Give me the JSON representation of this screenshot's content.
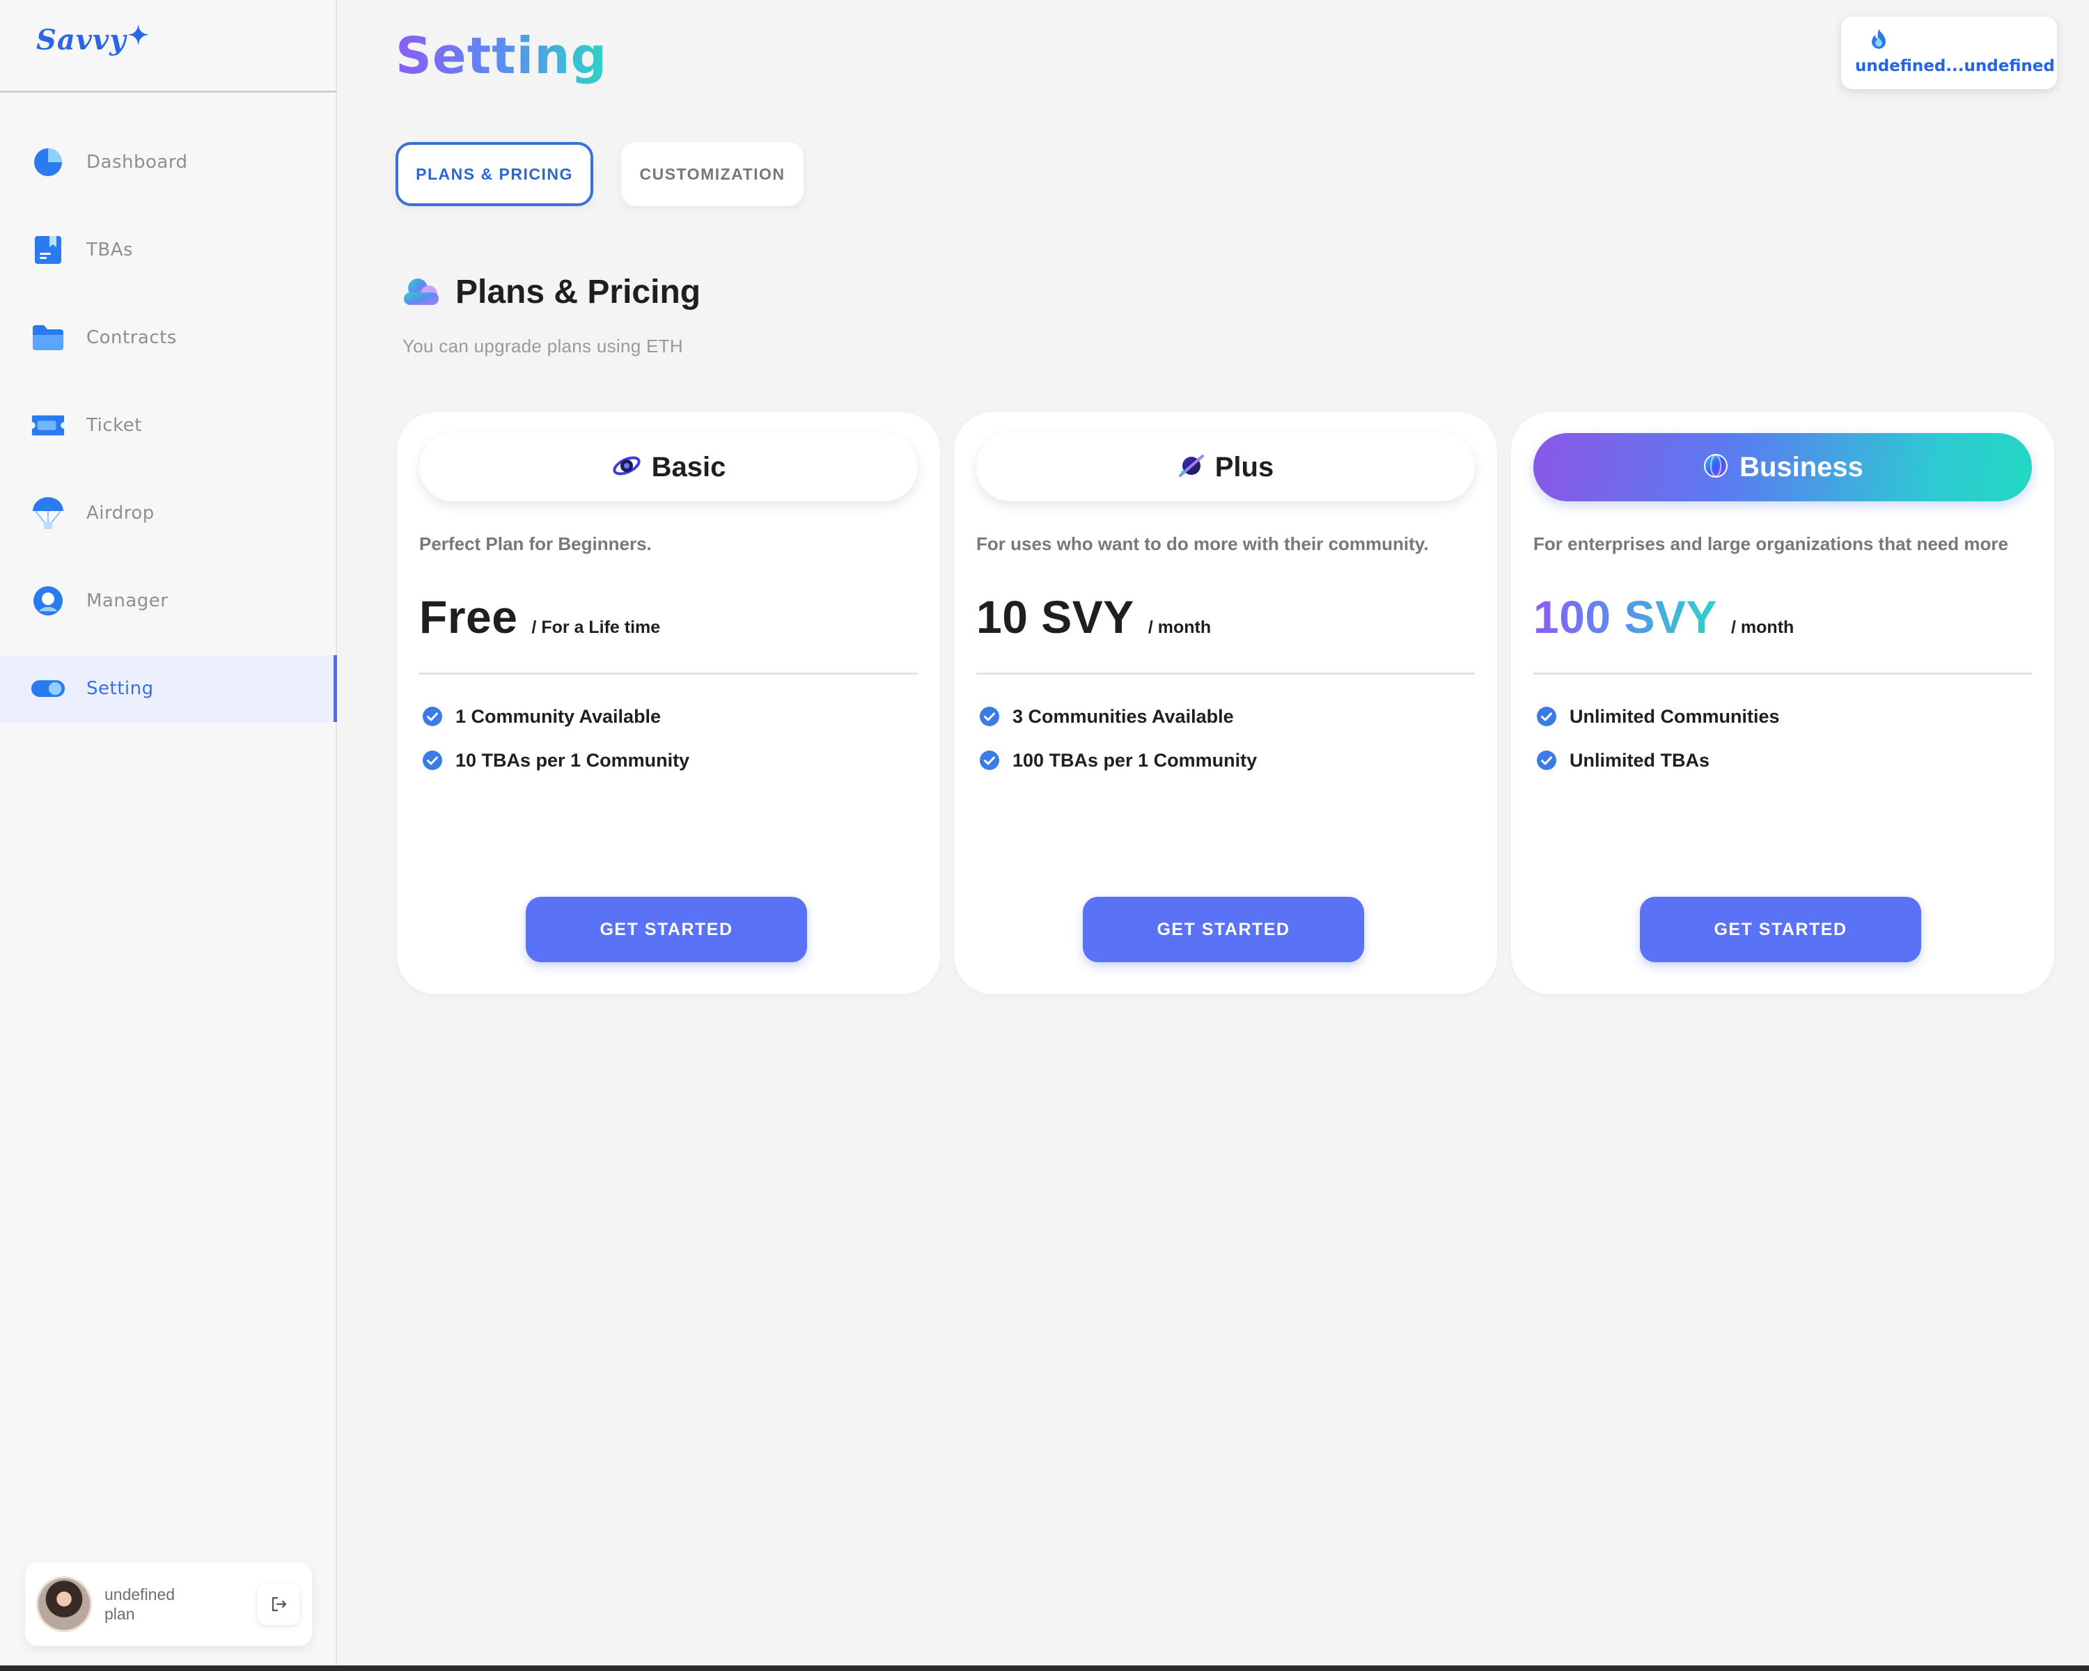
{
  "app": {
    "brand": "Savvy",
    "page_title": "Setting",
    "wallet_label": "undefined...undefined"
  },
  "sidebar": {
    "items": [
      {
        "label": "Dashboard",
        "icon": "pie-chart-icon",
        "active": false
      },
      {
        "label": "TBAs",
        "icon": "bookmark-doc-icon",
        "active": false
      },
      {
        "label": "Contracts",
        "icon": "folder-icon",
        "active": false
      },
      {
        "label": "Ticket",
        "icon": "ticket-icon",
        "active": false
      },
      {
        "label": "Airdrop",
        "icon": "parachute-icon",
        "active": false
      },
      {
        "label": "Manager",
        "icon": "user-circle-icon",
        "active": false
      },
      {
        "label": "Setting",
        "icon": "toggle-icon",
        "active": true
      }
    ],
    "user": {
      "name": "undefined",
      "plan": "plan"
    }
  },
  "tabs": [
    {
      "label": "PLANS & PRICING",
      "active": true
    },
    {
      "label": "CUSTOMIZATION",
      "active": false
    }
  ],
  "section": {
    "title": "Plans & Pricing",
    "subtitle": "You can upgrade plans using ETH"
  },
  "plans": [
    {
      "name": "Basic",
      "description": "Perfect Plan for Beginners.",
      "price": "Free",
      "period": "/ For a Life time",
      "features": [
        "1 Community Available",
        "10 TBAs per 1 Community"
      ],
      "cta": "GET STARTED"
    },
    {
      "name": "Plus",
      "description": "For uses who want to do more with their community.",
      "price": "10 SVY",
      "period": "/ month",
      "features": [
        "3 Communities Available",
        "100 TBAs per 1 Community"
      ],
      "cta": "GET STARTED"
    },
    {
      "name": "Business",
      "description": "For enterprises and large organizations that need more",
      "price": "100 SVY",
      "period": "/ month",
      "features": [
        "Unlimited Communities",
        "Unlimited TBAs"
      ],
      "cta": "GET STARTED"
    }
  ],
  "colors": {
    "accent": "#5a72f5",
    "active_tab": "#3a6fd8",
    "nav_active_text": "#3d6de8",
    "check": "#3a7be6"
  }
}
